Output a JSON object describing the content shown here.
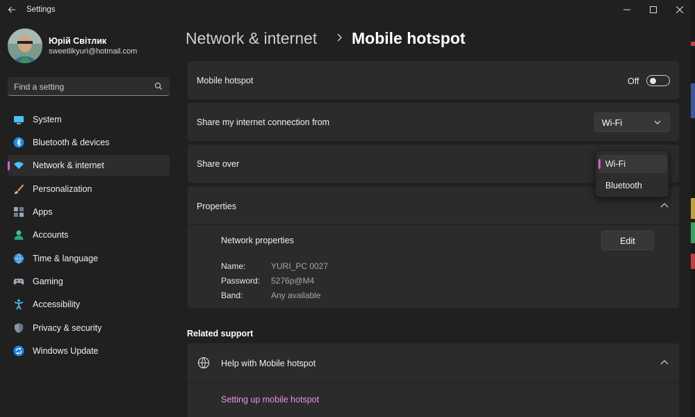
{
  "window": {
    "title": "Settings"
  },
  "profile": {
    "name": "Юрій Світлик",
    "email": "sweetlikyuri@hotmail.com"
  },
  "search": {
    "placeholder": "Find a setting"
  },
  "nav": {
    "items": [
      {
        "label": "System",
        "icon": "monitor-icon"
      },
      {
        "label": "Bluetooth & devices",
        "icon": "bluetooth-icon"
      },
      {
        "label": "Network & internet",
        "icon": "wifi-icon",
        "active": true
      },
      {
        "label": "Personalization",
        "icon": "brush-icon"
      },
      {
        "label": "Apps",
        "icon": "apps-icon"
      },
      {
        "label": "Accounts",
        "icon": "person-icon"
      },
      {
        "label": "Time & language",
        "icon": "globe-clock-icon"
      },
      {
        "label": "Gaming",
        "icon": "gamepad-icon"
      },
      {
        "label": "Accessibility",
        "icon": "accessibility-icon"
      },
      {
        "label": "Privacy & security",
        "icon": "shield-icon"
      },
      {
        "label": "Windows Update",
        "icon": "update-icon"
      }
    ]
  },
  "breadcrumb": {
    "parent": "Network & internet",
    "current": "Mobile hotspot"
  },
  "hotspot": {
    "label": "Mobile hotspot",
    "state": "Off"
  },
  "share_from": {
    "label": "Share my internet connection from",
    "value": "Wi-Fi"
  },
  "share_over": {
    "label": "Share over",
    "options": [
      "Wi-Fi",
      "Bluetooth"
    ],
    "selected": "Wi-Fi"
  },
  "properties": {
    "label": "Properties",
    "network_label": "Network properties",
    "edit_label": "Edit",
    "fields": [
      {
        "key": "Name:",
        "value": "YURI_PC 0027"
      },
      {
        "key": "Password:",
        "value": "5276p@M4"
      },
      {
        "key": "Band:",
        "value": "Any available"
      }
    ]
  },
  "related": {
    "title": "Related support",
    "help_label": "Help with Mobile hotspot",
    "link": "Setting up mobile hotspot"
  },
  "colors": {
    "accent": "#d55fd4",
    "link": "#f08ef0",
    "background": "#202020",
    "card": "#2b2b2b"
  }
}
